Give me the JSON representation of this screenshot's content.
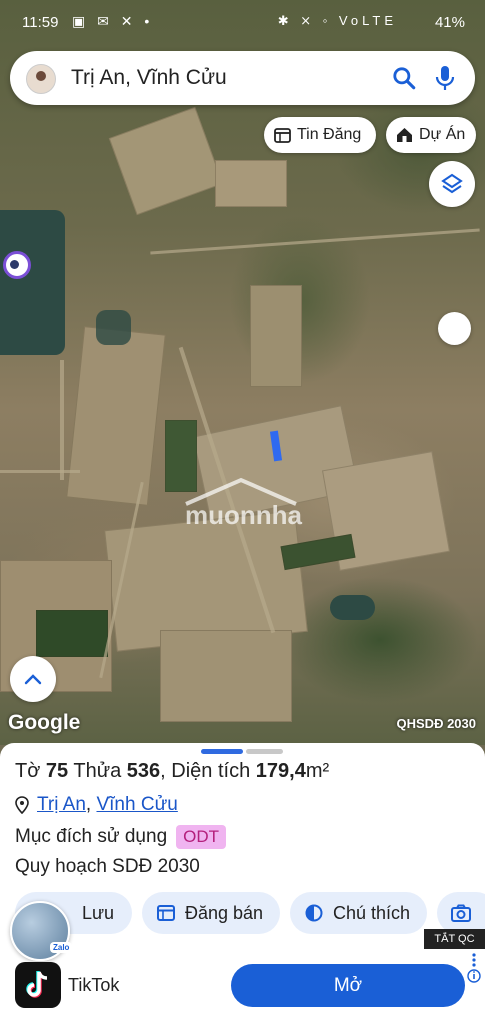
{
  "status": {
    "time": "11:59",
    "left_icons": "▣ ✉ ✕ •",
    "right_icons": "✱ ⨯ ◦ VoLTE",
    "battery": "41%"
  },
  "search": {
    "query": "Trị An, Vĩnh Cửu"
  },
  "chips": {
    "tin_dang": "Tin Đăng",
    "du_an": "Dự Án"
  },
  "map": {
    "watermark": "muonnha",
    "logo": "Google",
    "layer_label": "QHSDĐ 2030"
  },
  "parcel": {
    "sheet_label": "Tờ",
    "sheet_no": "75",
    "plot_label": "Thửa",
    "plot_no": "536",
    "area_label": ", Diện tích",
    "area_value": "179,4",
    "area_unit": "m²",
    "commune": "Trị An",
    "district": "Vĩnh Cửu",
    "purpose_label": "Mục đích sử dụng",
    "purpose_code": "ODT",
    "plan_label": "Quy hoạch SDĐ 2030"
  },
  "actions": {
    "save": "Lưu",
    "post_sale": "Đăng bán",
    "legend": "Chú thích"
  },
  "ad": {
    "close": "TẮT QC",
    "app_name": "TikTok",
    "open": "Mở",
    "zalo": "Zalo"
  }
}
